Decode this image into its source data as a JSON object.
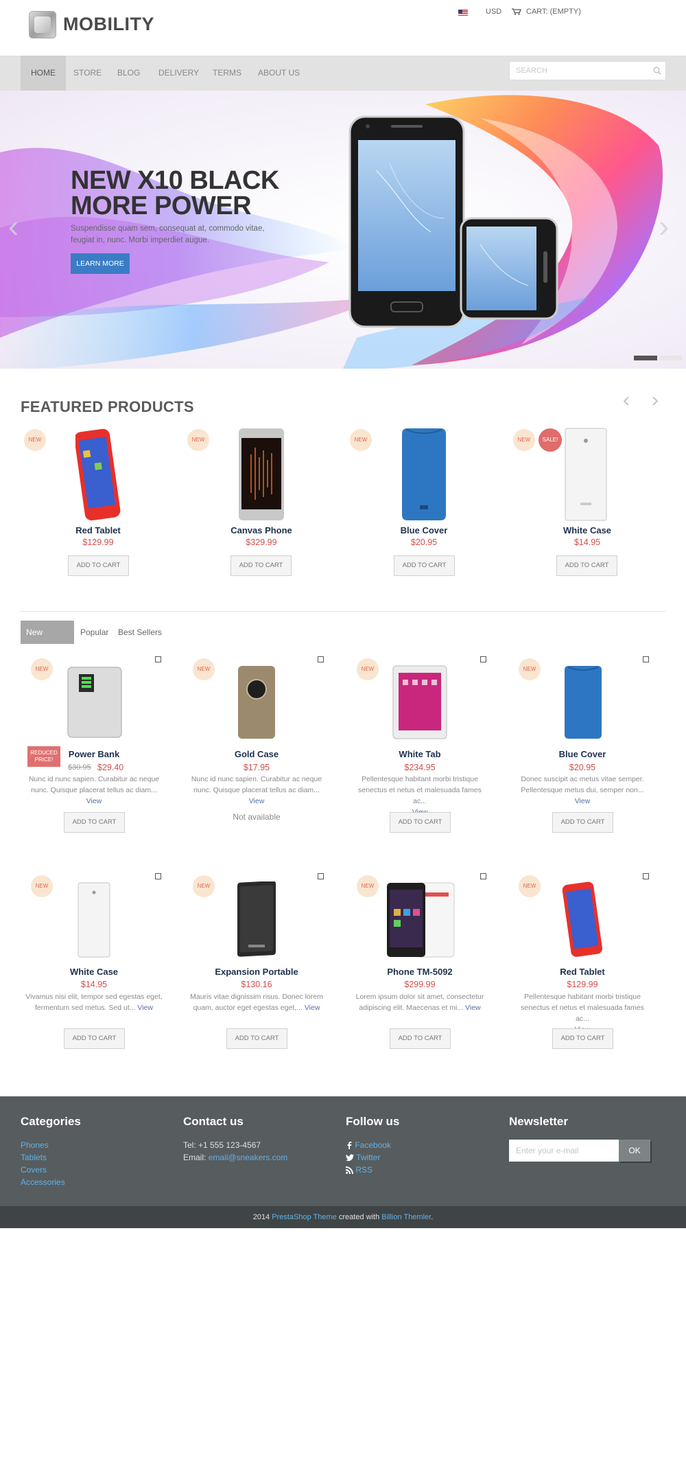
{
  "header": {
    "logo_text": "MOBILITY",
    "currency": "USD",
    "cart_label": "CART: (EMPTY)"
  },
  "nav": {
    "items": [
      {
        "label": "HOME"
      },
      {
        "label": "STORE"
      },
      {
        "label": "BLOG"
      },
      {
        "label": "DELIVERY"
      },
      {
        "label": "TERMS"
      },
      {
        "label": "ABOUT US"
      }
    ],
    "search_placeholder": "SEARCH"
  },
  "hero": {
    "title_line1": "NEW X10 BLACK",
    "title_line2": "MORE POWER",
    "subtitle": "Suspendisse quam sem, consequat at, commodo vitae, feugiat in, nunc. Morbi imperdiet augue.",
    "button": "LEARN MORE",
    "prev": "‹",
    "next": "›"
  },
  "featured": {
    "title": "FEATURED PRODUCTS",
    "prev": "‹",
    "next": "›",
    "badge_new": "NEW",
    "badge_sale": "SALE!",
    "add_to_cart": "ADD TO CART",
    "products": [
      {
        "name": "Red Tablet",
        "price": "$129.99"
      },
      {
        "name": "Canvas Phone",
        "price": "$329.99"
      },
      {
        "name": "Blue Cover",
        "price": "$20.95"
      },
      {
        "name": "White Case",
        "price": "$14.95"
      }
    ]
  },
  "tabs": {
    "items": [
      {
        "label": "New arrivals"
      },
      {
        "label": "Popular"
      },
      {
        "label": "Best Sellers"
      }
    ]
  },
  "grid": {
    "badge_new": "NEW",
    "reduced_line1": "REDUCED",
    "reduced_line2": "PRICE!",
    "add_to_cart": "ADD TO CART",
    "view": "View",
    "not_available": "Not available",
    "products": [
      {
        "name": "Power Bank",
        "old_price": "$30.95",
        "price": "$29.40",
        "desc": "Nunc id nunc sapien. Curabitur ac neque nunc. Quisque placerat tellus ac diam..."
      },
      {
        "name": "Gold Case",
        "price": "$17.95",
        "desc": "Nunc id nunc sapien. Curabitur ac neque nunc. Quisque placerat tellus ac diam..."
      },
      {
        "name": "White Tab",
        "price": "$234.95",
        "desc": "Pellentesque habitant morbi tristique senectus et netus et malesuada fames ac..."
      },
      {
        "name": "Blue Cover",
        "price": "$20.95",
        "desc": "Donec suscipit ac metus vitae semper. Pellentesque metus dui, semper non..."
      },
      {
        "name": "White Case",
        "price": "$14.95",
        "desc": "Vivamus nisi elit, tempor sed egestas eget, fermentum sed metus. Sed ut..."
      },
      {
        "name": "Expansion Portable",
        "price": "$130.16",
        "desc": "Mauris vitae dignissim risus. Donec lorem quam, auctor eget egestas eget,..."
      },
      {
        "name": "Phone TM-5092",
        "price": "$299.99",
        "desc": "Lorem ipsum dolor sit amet, consectetur adipiscing elit. Maecenas et mi..."
      },
      {
        "name": "Red Tablet",
        "price": "$129.99",
        "desc": "Pellentesque habitant morbi tristique senectus et netus et malesuada fames ac..."
      }
    ]
  },
  "footer": {
    "categories": {
      "title": "Categories",
      "links": [
        "Phones",
        "Tablets",
        "Covers",
        "Accessories"
      ]
    },
    "contact": {
      "title": "Contact us",
      "tel": "Tel: +1 555 123-4567",
      "email_label": "Email:",
      "email": "email@sneakers.com"
    },
    "follow": {
      "title": "Follow us",
      "links": [
        "Facebook",
        "Twitter",
        "RSS"
      ]
    },
    "newsletter": {
      "title": "Newsletter",
      "placeholder": "Enter your e-mail",
      "button": "OK"
    },
    "bottom": {
      "year": "2014",
      "theme_link": "PrestaShop Theme",
      "created": "created with",
      "themer_link": "Billion Themler",
      "end": "."
    }
  },
  "colors": {
    "accent": "#3b7dc4",
    "price": "#d0504a",
    "link": "#60b2e8",
    "footer_bg": "#575c5e"
  }
}
